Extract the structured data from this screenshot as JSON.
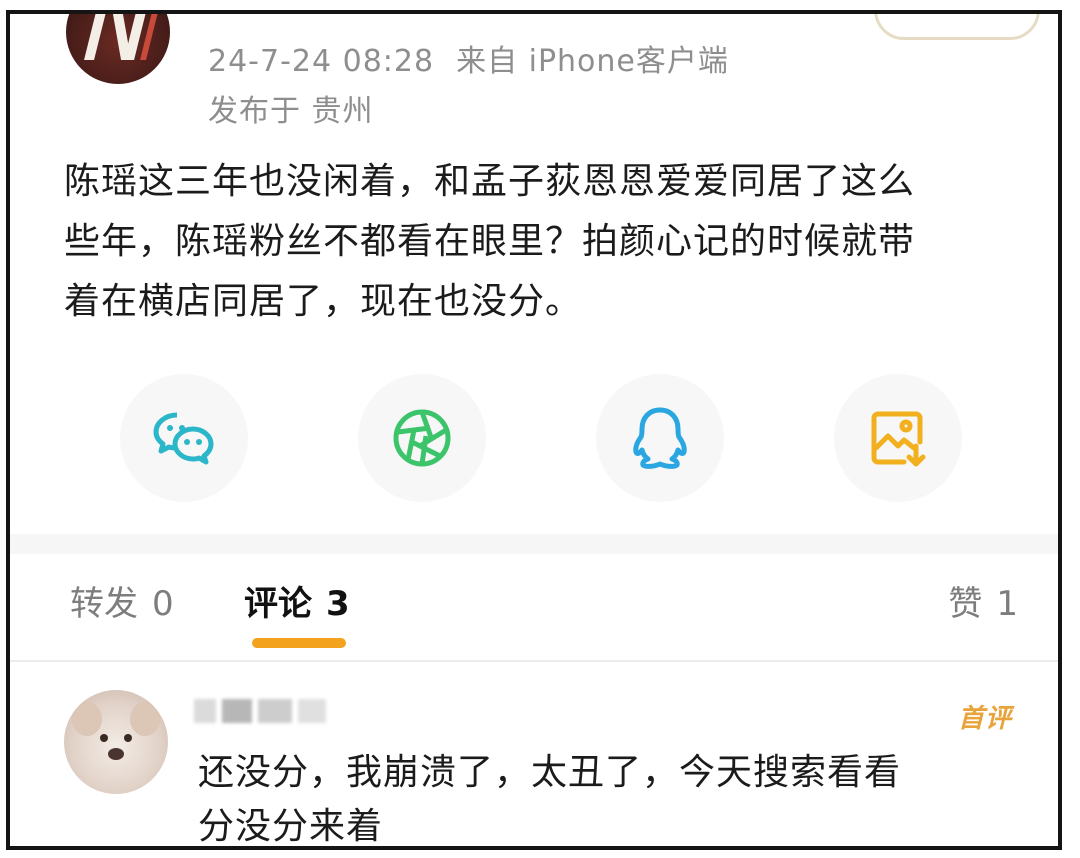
{
  "post": {
    "timestamp": "24-7-24 08:28",
    "source": "来自 iPhone客户端",
    "location": "发布于 贵州",
    "text_lines": [
      "陈瑶这三年也没闲着，和孟子荻恩恩爱爱同居了这么",
      "些年，陈瑶粉丝不都看在眼里？拍颜心记的时候就带",
      "着在横店同居了，现在也没分。"
    ]
  },
  "share": {
    "icons": [
      "wechat-icon",
      "moments-icon",
      "qq-icon",
      "save-image-icon"
    ],
    "colors": {
      "wechat": "#2bb6c9",
      "moments": "#3cc46a",
      "qq": "#2aa6e0",
      "save_image": "#f2b01e"
    }
  },
  "tabs": {
    "repost_label": "转发",
    "repost_count": "0",
    "comments_label": "评论",
    "comments_count": "3",
    "likes_label": "赞",
    "likes_count": "1",
    "accent_color": "#f2a21c"
  },
  "comment": {
    "badge": "首评",
    "text_lines": [
      "还没分，我崩溃了，太丑了，今天搜索看看",
      "分没分来着"
    ]
  }
}
